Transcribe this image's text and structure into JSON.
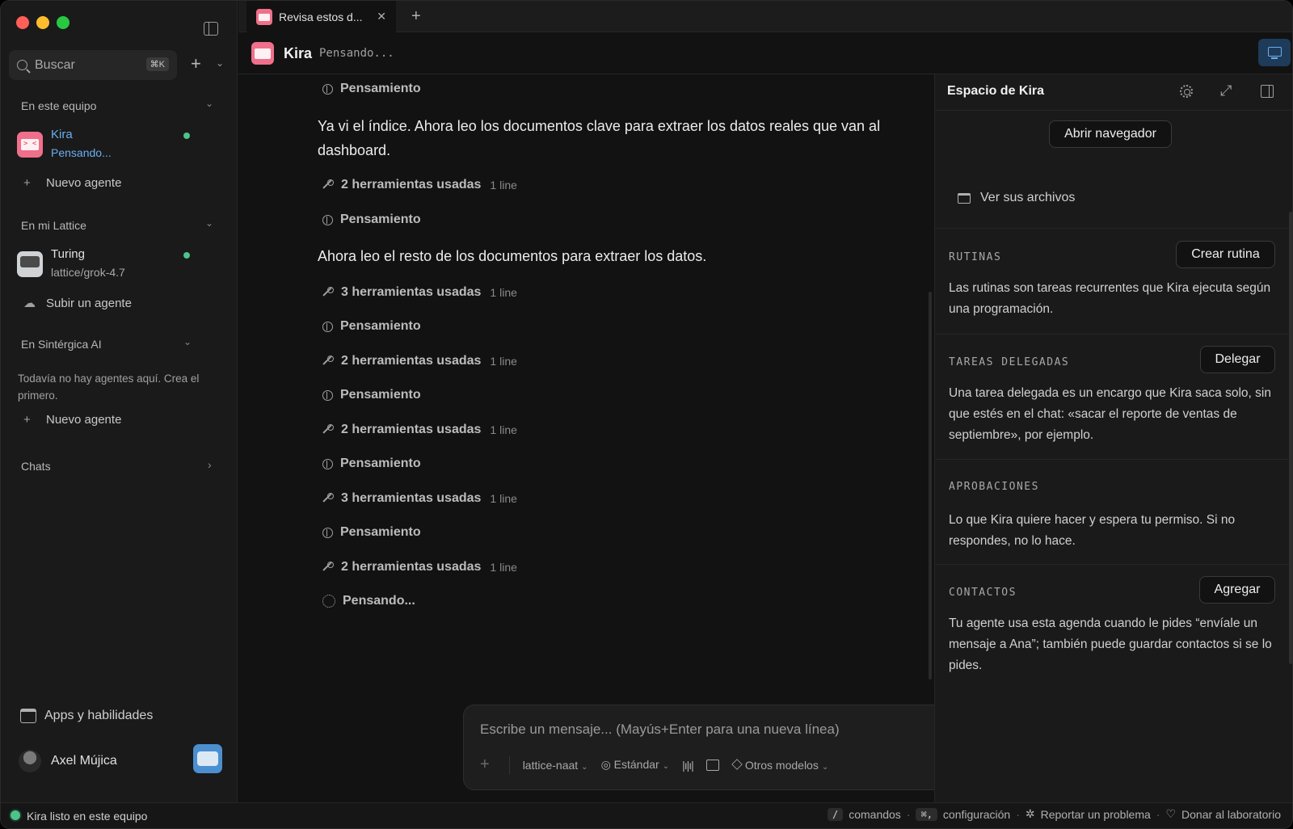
{
  "sidebar": {
    "search_placeholder": "Buscar",
    "search_shortcut": "⌘K",
    "section_team": "En este equipo",
    "agent_kira": {
      "name": "Kira",
      "status": "Pensando..."
    },
    "new_agent_1": "Nuevo agente",
    "section_lattice": "En mi Lattice",
    "agent_turing": {
      "name": "Turing",
      "status": "lattice/grok-4.7"
    },
    "upload_agent": "Subir un agente",
    "section_sintergica": "En Sintérgica AI",
    "empty_note": "Todavía no hay agentes aquí. Crea el primero.",
    "new_agent_2": "Nuevo agente",
    "section_chats": "Chats",
    "apps": "Apps y habilidades",
    "user_name": "Axel Mújica"
  },
  "tabbar": {
    "tab_title": "Revisa estos d...",
    "close": "✕",
    "add": "+"
  },
  "chat_header": {
    "name": "Kira",
    "status": "Pensando..."
  },
  "chat": {
    "thinking_1": "Pensamiento",
    "msg_1": "Ya vi el índice. Ahora leo los documentos clave para extraer los datos reales que van al dashboard.",
    "tools_1": "2 herramientas usadas",
    "tools_1_meta": "1 line",
    "thinking_2": "Pensamiento",
    "msg_2": "Ahora leo el resto de los documentos para extraer los datos.",
    "tools_2": "3 herramientas usadas",
    "tools_2_meta": "1 line",
    "thinking_3": "Pensamiento",
    "tools_3": "2 herramientas usadas",
    "tools_3_meta": "1 line",
    "thinking_4": "Pensamiento",
    "tools_4": "2 herramientas usadas",
    "tools_4_meta": "1 line",
    "thinking_5": "Pensamiento",
    "tools_5": "3 herramientas usadas",
    "tools_5_meta": "1 line",
    "thinking_6": "Pensamiento",
    "tools_6": "2 herramientas usadas",
    "tools_6_meta": "1 line",
    "pending": "Pensando..."
  },
  "composer": {
    "placeholder": "Escribe un mensaje... (Mayús+Enter para una nueva línea)",
    "model": "lattice-naat",
    "mode": "Estándar",
    "other_models": "Otros modelos"
  },
  "panel": {
    "title": "Espacio de Kira",
    "open_browser": "Abrir navegador",
    "view_files": "Ver sus archivos",
    "routines_label": "RUTINAS",
    "routines_button": "Crear rutina",
    "routines_text": "Las rutinas son tareas recurrentes que Kira ejecuta según una programación.",
    "delegated_label": "TAREAS DELEGADAS",
    "delegated_button": "Delegar",
    "delegated_text": "Una tarea delegada es un encargo que Kira saca solo, sin que estés en el chat: «sacar el reporte de ventas de septiembre», por ejemplo.",
    "approvals_label": "APROBACIONES",
    "approvals_text": "Lo que Kira quiere hacer y espera tu permiso. Si no respondes, no lo hace.",
    "contacts_label": "CONTACTOS",
    "contacts_button": "Agregar",
    "contacts_text": "Tu agente usa esta agenda cuando le pides “envíale un mensaje a Ana”; también puede guardar contactos si se lo pides."
  },
  "statusbar": {
    "message": "Kira listo en este equipo",
    "slash_key": "/",
    "slash_label": "comandos",
    "settings_key": "⌘,",
    "settings_label": "configuración",
    "report": "Reportar un problema",
    "donate": "Donar al laboratorio"
  },
  "colors": {
    "accent": "#6aaef0",
    "online": "#4cc38a",
    "kira": "#f06f8a"
  }
}
